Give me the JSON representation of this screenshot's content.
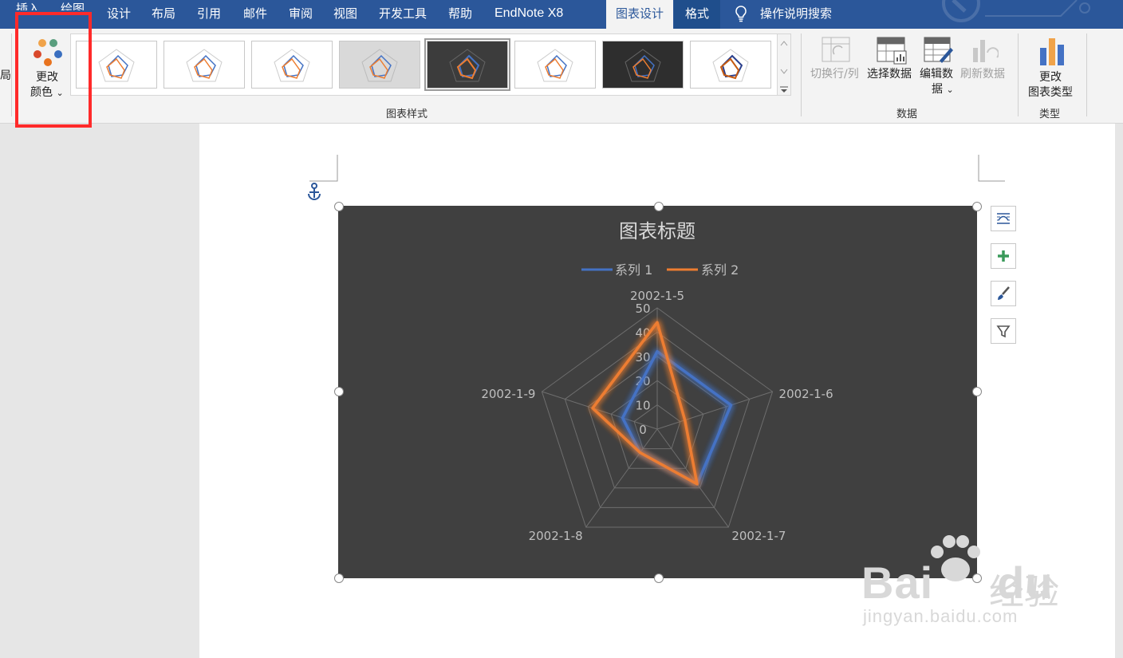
{
  "tabs": [
    {
      "label": "插入"
    },
    {
      "label": "绘图"
    },
    {
      "label": "设计"
    },
    {
      "label": "布局"
    },
    {
      "label": "引用"
    },
    {
      "label": "邮件"
    },
    {
      "label": "审阅"
    },
    {
      "label": "视图"
    },
    {
      "label": "开发工具"
    },
    {
      "label": "帮助"
    },
    {
      "label": "EndNote X8"
    },
    {
      "label": "图表设计"
    },
    {
      "label": "格式"
    }
  ],
  "tell_me": "操作说明搜索",
  "ribbon": {
    "left_fragment": "局",
    "change_colors": {
      "line1": "更改",
      "line2": "颜色",
      "caret": "⌄"
    },
    "chart_styles_label": "图表样式",
    "data_group": {
      "label": "数据",
      "switch": "切换行/列",
      "select": "选择数据",
      "edit_line1": "编辑数",
      "edit_line2": "据",
      "edit_caret": "⌄",
      "refresh": "刷新数据"
    },
    "type_group": {
      "label": "类型",
      "line1": "更改",
      "line2": "图表类型"
    }
  },
  "chart_data": {
    "type": "radar",
    "title": "图表标题",
    "categories": [
      "2002-1-5",
      "2002-1-6",
      "2002-1-7",
      "2002-1-8",
      "2002-1-9"
    ],
    "series": [
      {
        "name": "系列 1",
        "color": "#4472c4",
        "values": [
          32,
          32,
          28,
          12,
          15
        ]
      },
      {
        "name": "系列 2",
        "color": "#ed7d31",
        "values": [
          44,
          12,
          28,
          12,
          28
        ]
      }
    ],
    "rlim": [
      0,
      50
    ],
    "ticks": [
      "0",
      "10",
      "20",
      "30",
      "40",
      "50"
    ],
    "background": "#404040"
  },
  "watermark": {
    "brand": "Bai",
    "brand2": "du",
    "cn": "经验",
    "url": "jingyan.baidu.com"
  },
  "colors": {
    "accent": "#2b579a",
    "highlight": "#ff2a2a"
  }
}
